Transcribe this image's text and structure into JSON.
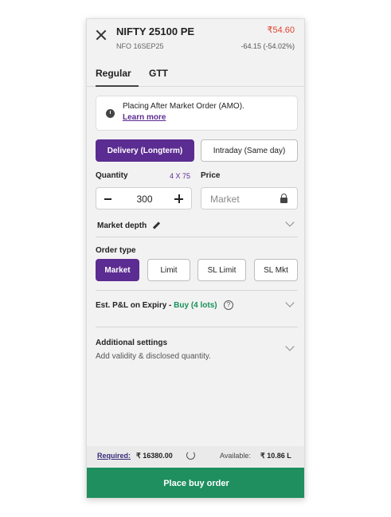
{
  "header": {
    "title": "NIFTY 25100 PE",
    "subtitle": "NFO 16SEP25",
    "price": "₹54.60",
    "change": "-64.15 (-54.02%)"
  },
  "tabs": [
    {
      "label": "Regular",
      "active": true
    },
    {
      "label": "GTT",
      "active": false
    }
  ],
  "notice": {
    "text": "Placing After Market Order (AMO).",
    "link": "Learn more"
  },
  "product": {
    "delivery": "Delivery (Longterm)",
    "intraday": "Intraday (Same day)",
    "selected": "delivery"
  },
  "quantity": {
    "label": "Quantity",
    "lot_info": "4 X 75",
    "value": "300"
  },
  "price_field": {
    "label": "Price",
    "placeholder": "Market"
  },
  "market_depth": {
    "label": "Market depth"
  },
  "order_type": {
    "label": "Order type",
    "options": [
      "Market",
      "Limit",
      "SL Limit",
      "SL Mkt"
    ],
    "selected": "Market"
  },
  "pnl": {
    "label": "Est. P&L on Expiry - ",
    "buy": "Buy (4 lots)",
    "help": "?"
  },
  "additional": {
    "title": "Additional settings",
    "subtitle": "Add validity & disclosed quantity."
  },
  "footer": {
    "required_label": "Required:",
    "required_value": "₹ 16380.00",
    "available_label": "Available:",
    "available_value": "₹ 10.86 L"
  },
  "submit_label": "Place buy order",
  "colors": {
    "accent": "#5b2c91",
    "positive": "#18905a",
    "submit": "#1f8f5f",
    "price_red": "#e0442e"
  }
}
